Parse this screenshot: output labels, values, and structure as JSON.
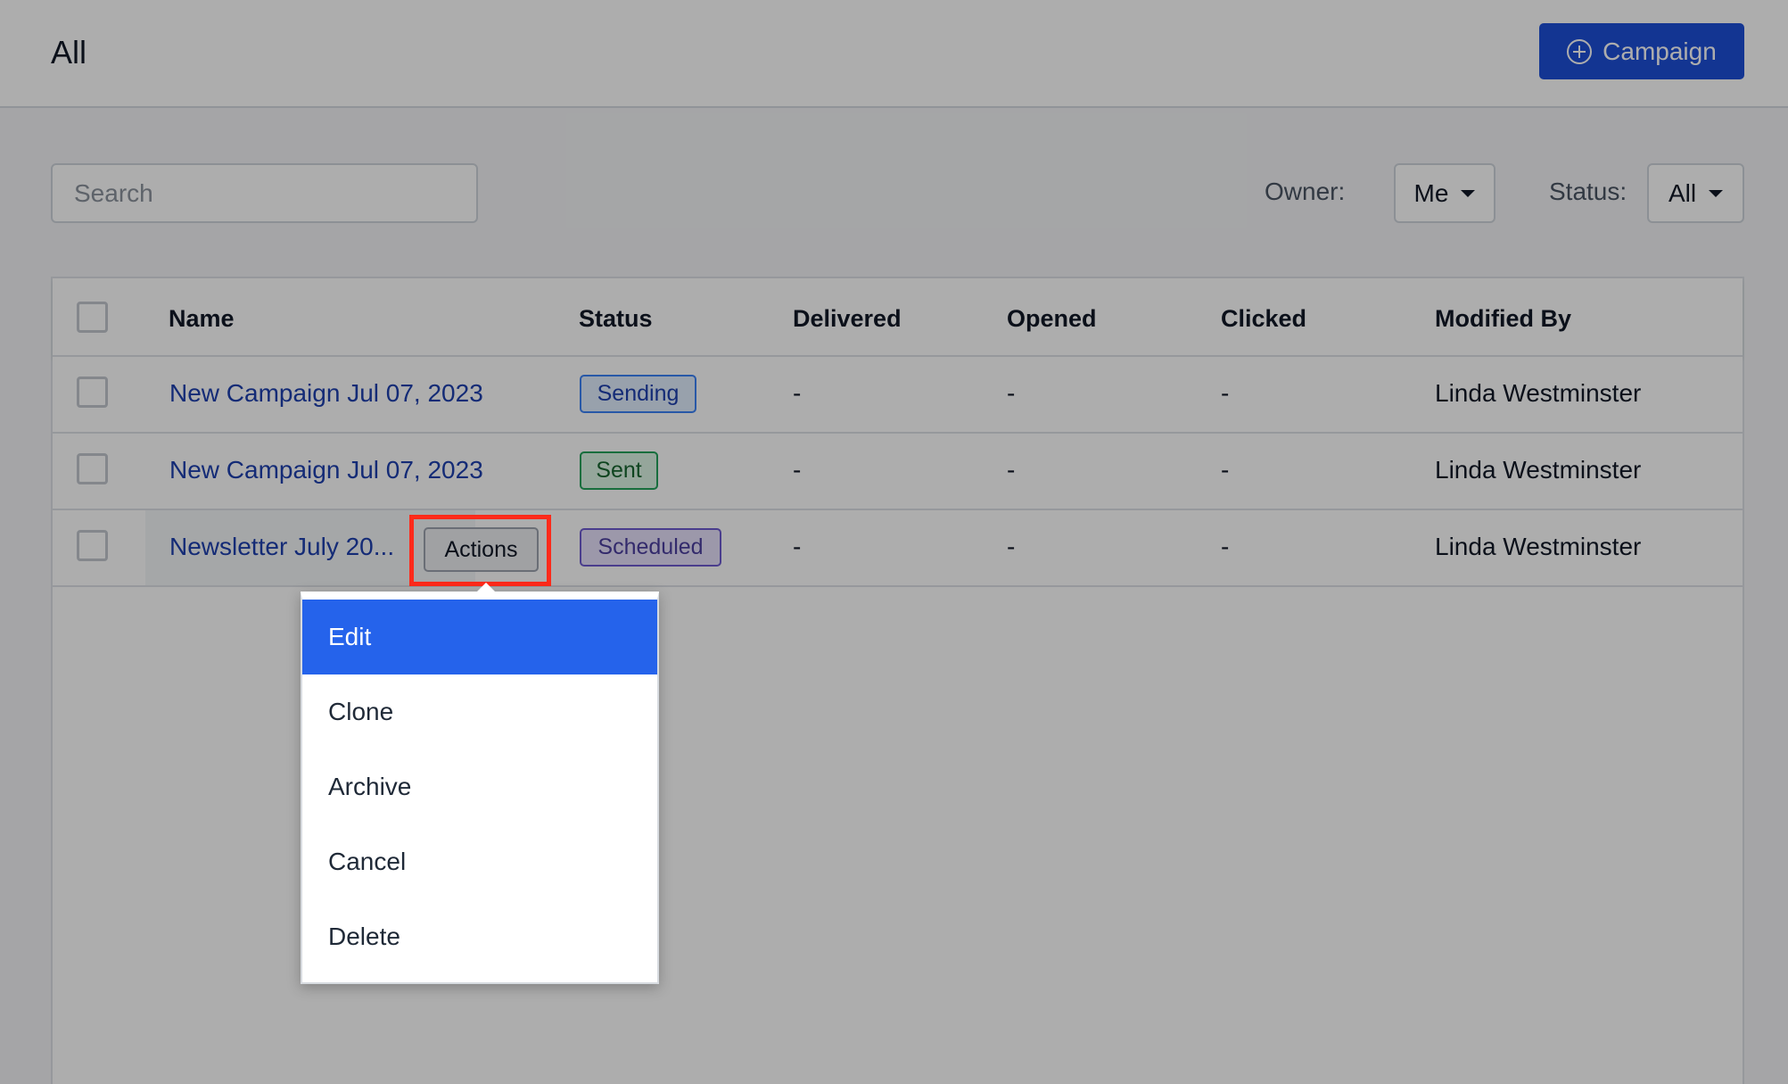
{
  "header": {
    "title": "All",
    "new_campaign_label": "Campaign"
  },
  "filters": {
    "search_placeholder": "Search",
    "owner_label": "Owner:",
    "owner_value": "Me",
    "status_label": "Status:",
    "status_value": "All"
  },
  "table": {
    "columns": [
      "Name",
      "Status",
      "Delivered",
      "Opened",
      "Clicked",
      "Modified By"
    ],
    "rows": [
      {
        "name": "New Campaign Jul 07, 2023",
        "status": "Sending",
        "delivered": "-",
        "opened": "-",
        "clicked": "-",
        "modified_by": "Linda Westminster"
      },
      {
        "name": "New Campaign Jul 07, 2023",
        "status": "Sent",
        "delivered": "-",
        "opened": "-",
        "clicked": "-",
        "modified_by": "Linda Westminster"
      },
      {
        "name": "Newsletter July 20...",
        "status": "Scheduled",
        "delivered": "-",
        "opened": "-",
        "clicked": "-",
        "modified_by": "Linda Westminster"
      }
    ],
    "row_actions_label": "Actions"
  },
  "actions_menu": {
    "items": [
      "Edit",
      "Clone",
      "Archive",
      "Cancel",
      "Delete"
    ],
    "highlighted": "Edit"
  },
  "colors": {
    "primary": "#1d4ed8",
    "highlight": "#2563eb",
    "annotation": "#ff2a1a"
  },
  "icons": {
    "new_campaign": "plus-circle-icon",
    "dropdown": "caret-down-icon"
  }
}
